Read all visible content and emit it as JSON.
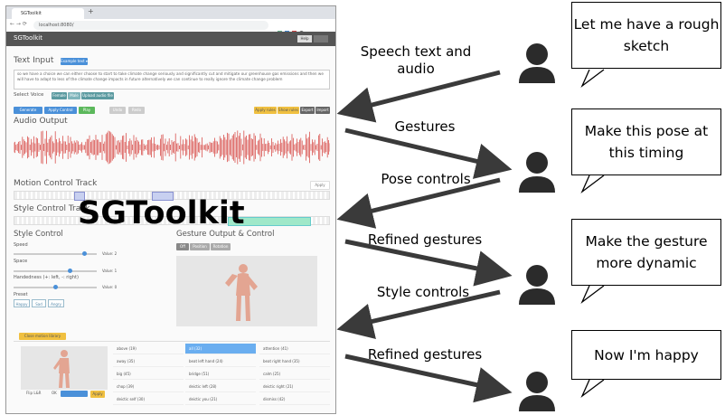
{
  "screenshot": {
    "tab_title": "SGToolkit",
    "url": "localhost:8080/",
    "app_name": "SGToolkit",
    "help_label": "Help",
    "text_input_heading": "Text Input",
    "text_input_button": "Example text ▾",
    "text_input_value": "so we have a choice we can either choose to start to take climate change seriously and significantly cut and mitigate our greenhouse gas emissions and then we will have to adapt to less of the climate change impacts in future alternatively we can continue to really ignore the climate change problem",
    "select_voice_label": "Select Voice",
    "voice_buttons": [
      "Female",
      "Male",
      "Upload audio file"
    ],
    "action_buttons": [
      "Generate",
      "Apply Control",
      "Play"
    ],
    "undo_label": "Undo",
    "redo_label": "Redo",
    "right_buttons": [
      "Apply rules",
      "Show rules",
      "Export",
      "Import"
    ],
    "audio_output_heading": "Audio Output",
    "motion_track_heading": "Motion Control Track",
    "apply_label": "Apply",
    "style_track_heading": "Style Control Track",
    "style_control_heading": "Style Control",
    "speed_label": "Speed",
    "speed_value": "Value: 2",
    "space_label": "Space",
    "space_value": "Value: 1",
    "handedness_label": "Handedness (+: left, -: right)",
    "handedness_value": "Value: 0",
    "preset_label": "Preset",
    "preset_buttons": [
      "Happy",
      "Sad",
      "Angry"
    ],
    "gesture_heading": "Gesture Output & Control",
    "gesture_tabs": [
      "Off",
      "Position",
      "Rotation"
    ],
    "close_library_label": "Close motion library",
    "flip_label": "Flip L&R",
    "ok_label": "OK",
    "apply_small_label": "Apply",
    "library_columns": [
      [
        "above (19)",
        "away (35)",
        "big (45)",
        "chop (39)",
        "deictic self (30)"
      ],
      [
        "all (32)",
        "beat left hand (24)",
        "bridge (51)",
        "deictic left (28)",
        "deictic you (21)"
      ],
      [
        "attention (41)",
        "beat right hand (35)",
        "calm (25)",
        "deictic right (21)",
        "dismiss (42)"
      ]
    ]
  },
  "overlay_title": "SGToolkit",
  "flow": {
    "arrow_labels": [
      "Speech text and audio",
      "Gestures",
      "Pose controls",
      "Refined gestures",
      "Style controls",
      "Refined gestures"
    ],
    "bubbles": [
      "Let me have a rough sketch",
      "Make this pose at this timing",
      "Make the gesture more dynamic",
      "Now I'm happy"
    ]
  },
  "colors": {
    "arrow": "#3a3a3a",
    "person": "#2b2b2b",
    "waveform": "#d9534f",
    "primary_button": "#4a90d9",
    "success_button": "#5cb85c",
    "warning_button": "#f0c040",
    "style_track": "#9fe8c9"
  }
}
